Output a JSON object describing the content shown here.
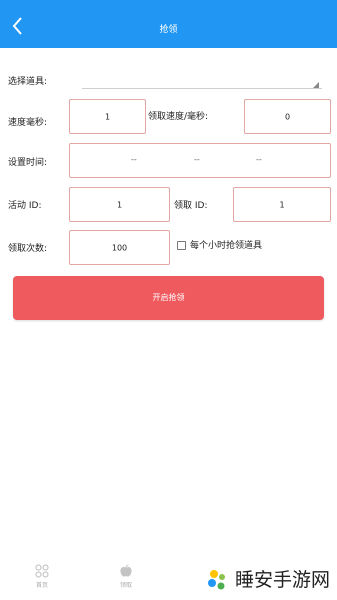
{
  "header": {
    "title": "抢领"
  },
  "form": {
    "select_prop_label": "选择道具:",
    "speed_ms_label": "速度毫秒:",
    "speed_ms_value": "1",
    "claim_speed_label": "领取速度/毫秒:",
    "claim_speed_value": "0",
    "set_time_label": "设置时间:",
    "time_dashes": [
      "--",
      "--",
      "--"
    ],
    "activity_id_label": "活动 ID:",
    "activity_id_value": "1",
    "claim_id_label": "领取 ID:",
    "claim_id_value": "1",
    "claim_count_label": "领取次数:",
    "claim_count_value": "100",
    "hourly_checkbox_label": "每个小时抢领道具",
    "start_button_label": "开启抢领"
  },
  "tabbar": {
    "items": [
      {
        "label": "首页",
        "icon": "grid-icon"
      },
      {
        "label": "领取",
        "icon": "apple-icon"
      }
    ]
  },
  "watermark": {
    "text": "睡安手游网"
  },
  "colors": {
    "header": "#2196f3",
    "start_button": "#ef5a5f",
    "field_border": "#e3a6a2"
  }
}
